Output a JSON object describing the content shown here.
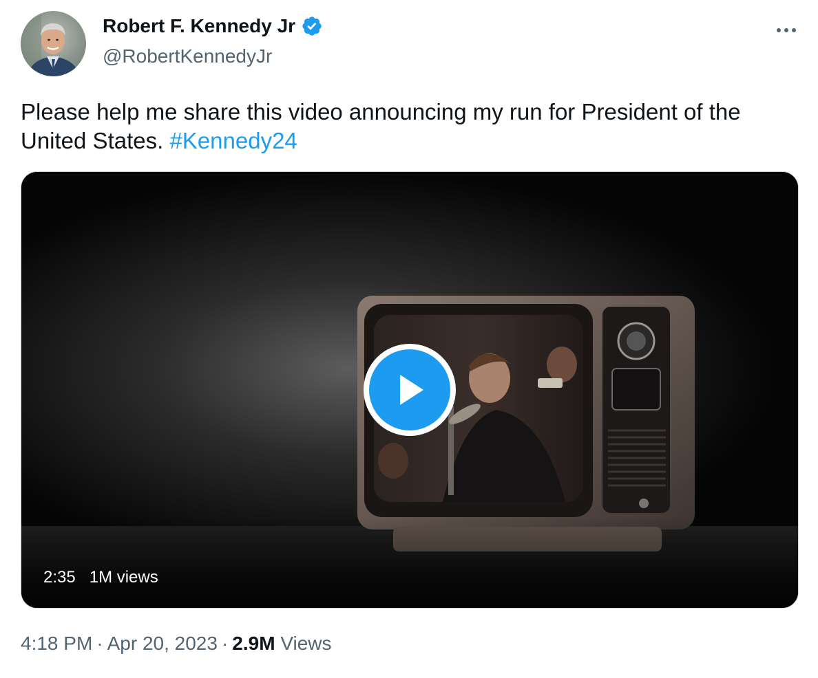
{
  "author": {
    "display_name": "Robert F. Kennedy Jr",
    "handle": "@RobertKennedyJr",
    "verified": true
  },
  "tweet": {
    "text": "Please help me share this video announcing my run for President of the United States.",
    "hashtag": "#Kennedy24"
  },
  "video": {
    "duration": "2:35",
    "views": "1M views"
  },
  "footer": {
    "time": "4:18 PM",
    "separator": "·",
    "date": "Apr 20, 2023",
    "views_count": "2.9M",
    "views_label": "Views"
  },
  "colors": {
    "accent": "#1d9bf0",
    "text": "#0f1419",
    "secondary": "#536471"
  },
  "icons": {
    "verified": "verified-badge-icon",
    "more": "more-options-icon",
    "play": "play-icon"
  }
}
